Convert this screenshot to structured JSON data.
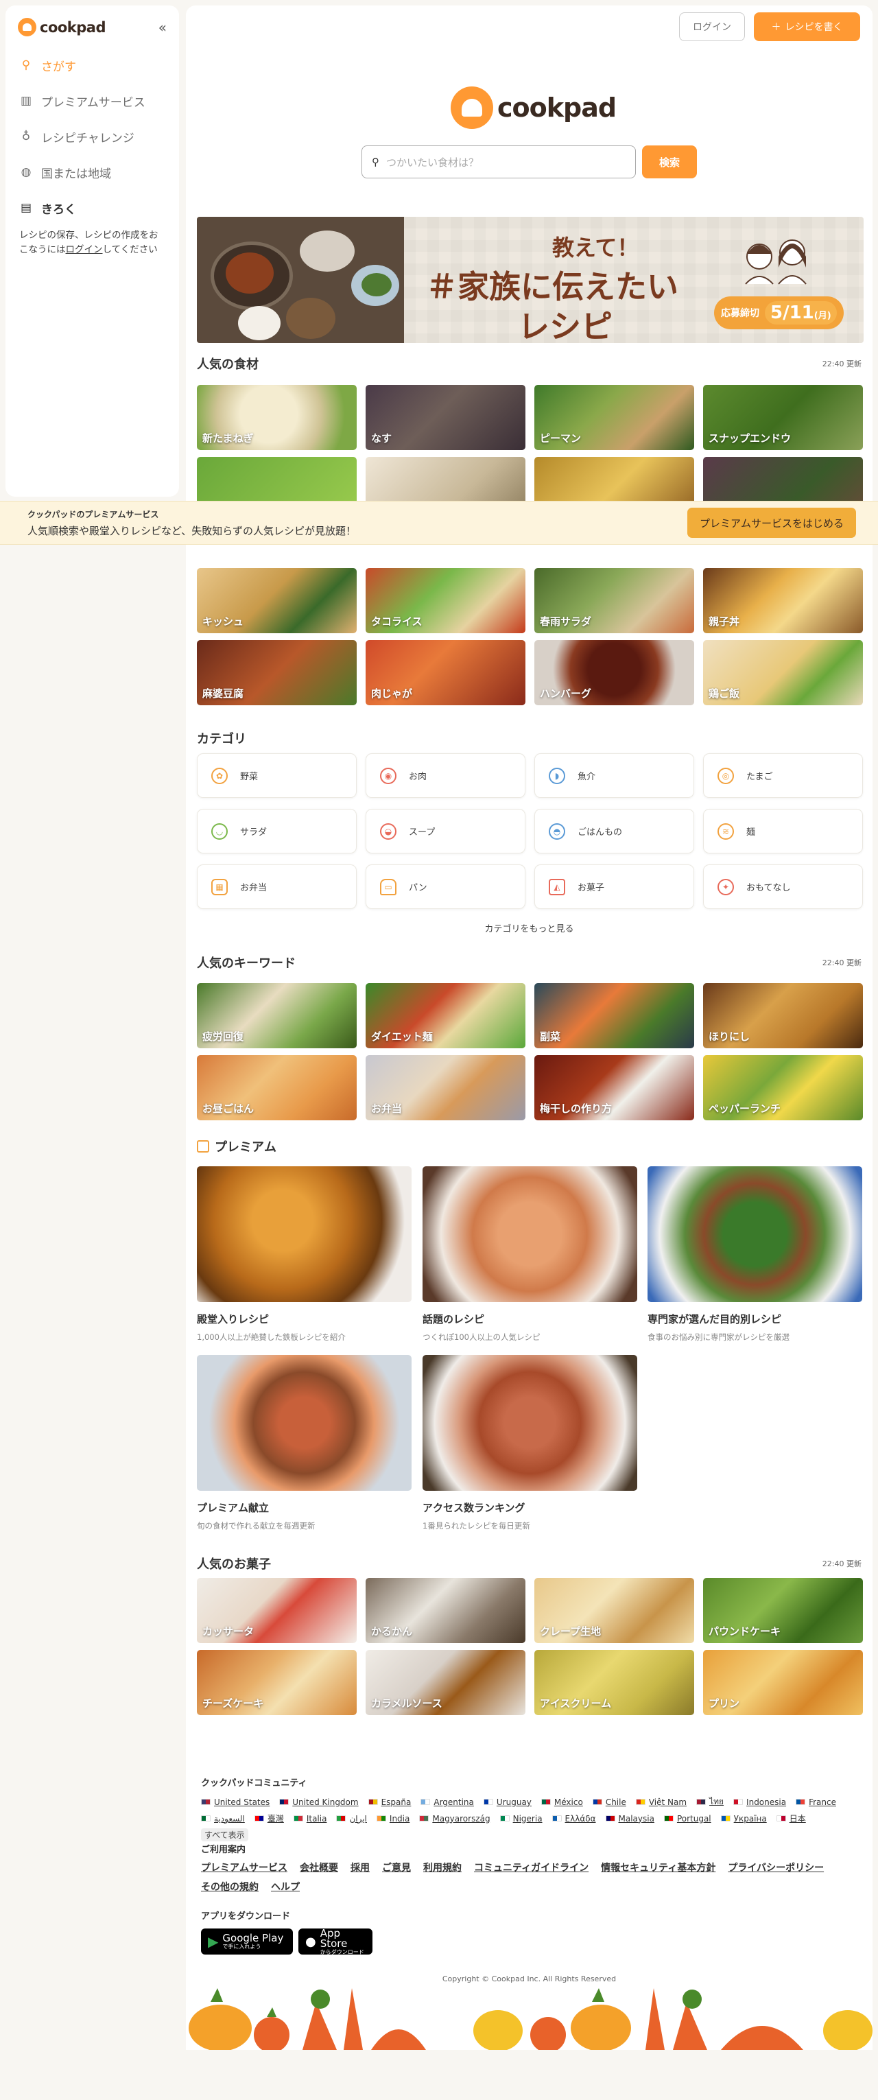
{
  "sidebar": {
    "logo_text": "cookpad",
    "items": [
      {
        "label": "さがす",
        "icon": "search-icon"
      },
      {
        "label": "プレミアムサービス",
        "icon": "premium-building-icon"
      },
      {
        "label": "レシピチャレンジ",
        "icon": "badge-icon"
      },
      {
        "label": "国または地域",
        "icon": "globe-icon"
      },
      {
        "label": "きろく",
        "icon": "notebook-icon"
      }
    ],
    "note_pre": "レシピの保存、レシピの作成をおこなうには",
    "note_link": "ログイン",
    "note_post": "してください"
  },
  "header": {
    "login_label": "ログイン",
    "write_label": "レシピを書く"
  },
  "hero": {
    "logo_text": "cookpad",
    "search_placeholder": "つかいたい食材は？",
    "search_button": "検索"
  },
  "banner": {
    "line1": "教えて！",
    "line2": "＃家族に伝えたい",
    "line3": "レシピ",
    "deadline_label": "応募締切",
    "deadline_date": "5/11",
    "deadline_day": "(月)"
  },
  "popular_ingredients": {
    "title": "人気の食材",
    "updated": "22:40 更新",
    "items": [
      "新たまねぎ",
      "なす",
      "ピーマン",
      "スナップエンドウ",
      "",
      "",
      "",
      ""
    ]
  },
  "premium_bar": {
    "title": "クックパッドのプレミアムサービス",
    "text": "人気順検索や殿堂入りレシピなど、失敗知らずの人気レシピが見放題！",
    "button": "プレミアムサービスをはじめる"
  },
  "popular_dishes": {
    "items": [
      "キッシュ",
      "タコライス",
      "春雨サラダ",
      "親子丼",
      "麻婆豆腐",
      "肉じゃが",
      "ハンバーグ",
      "鶏ご飯"
    ]
  },
  "categories": {
    "title": "カテゴリ",
    "items": [
      {
        "label": "野菜",
        "icon": "vegetable-icon"
      },
      {
        "label": "お肉",
        "icon": "meat-icon"
      },
      {
        "label": "魚介",
        "icon": "fish-icon"
      },
      {
        "label": "たまご",
        "icon": "egg-icon"
      },
      {
        "label": "サラダ",
        "icon": "salad-icon"
      },
      {
        "label": "スープ",
        "icon": "soup-icon"
      },
      {
        "label": "ごはんもの",
        "icon": "rice-icon"
      },
      {
        "label": "麺",
        "icon": "noodle-icon"
      },
      {
        "label": "お弁当",
        "icon": "bento-icon"
      },
      {
        "label": "パン",
        "icon": "bread-icon"
      },
      {
        "label": "お菓子",
        "icon": "cake-icon"
      },
      {
        "label": "おもてなし",
        "icon": "party-icon"
      }
    ],
    "more": "カテゴリをもっと見る"
  },
  "popular_keywords": {
    "title": "人気のキーワード",
    "updated": "22:40 更新",
    "items": [
      "疲労回復",
      "ダイエット麺",
      "副菜",
      "ほりにし",
      "お昼ごはん",
      "お弁当",
      "梅干しの作り方",
      "ペッパーランチ"
    ]
  },
  "premium": {
    "title": "プレミアム",
    "cards": [
      {
        "title": "殿堂入りレシピ",
        "sub": "1,000人以上が絶賛した鉄板レシピを紹介"
      },
      {
        "title": "話題のレシピ",
        "sub": "つくれぽ100人以上の人気レシピ"
      },
      {
        "title": "専門家が選んだ目的別レシピ",
        "sub": "食事のお悩み別に専門家がレシピを厳選"
      },
      {
        "title": "プレミアム献立",
        "sub": "旬の食材で作れる献立を毎週更新"
      },
      {
        "title": "アクセス数ランキング",
        "sub": "1番見られたレシピを毎日更新"
      }
    ]
  },
  "popular_sweets": {
    "title": "人気のお菓子",
    "updated": "22:40 更新",
    "items": [
      "カッサータ",
      "かるかん",
      "クレープ生地",
      "パウンドケーキ",
      "チーズケーキ",
      "カラメルソース",
      "アイスクリーム",
      "プリン"
    ]
  },
  "footer": {
    "community_title": "クックパッドコミュニティ",
    "countries": [
      {
        "name": "United States",
        "c1": "#3c3b6e",
        "c2": "#b22234"
      },
      {
        "name": "United Kingdom",
        "c1": "#012169",
        "c2": "#c8102e"
      },
      {
        "name": "España",
        "c1": "#aa151b",
        "c2": "#f1bf00"
      },
      {
        "name": "Argentina",
        "c1": "#74acdf",
        "c2": "#ffffff"
      },
      {
        "name": "Uruguay",
        "c1": "#0038a8",
        "c2": "#ffffff"
      },
      {
        "name": "México",
        "c1": "#006847",
        "c2": "#ce1126"
      },
      {
        "name": "Chile",
        "c1": "#0039a6",
        "c2": "#d52b1e"
      },
      {
        "name": "Việt Nam",
        "c1": "#da251d",
        "c2": "#ffcd00"
      },
      {
        "name": "ไทย",
        "c1": "#a51931",
        "c2": "#2d2a4a"
      },
      {
        "name": "Indonesia",
        "c1": "#ce1126",
        "c2": "#ffffff"
      },
      {
        "name": "France",
        "c1": "#0055a4",
        "c2": "#ef4135"
      },
      {
        "name": "السعودية",
        "c1": "#006c35",
        "c2": "#ffffff"
      },
      {
        "name": "臺灣",
        "c1": "#fe0000",
        "c2": "#000095"
      },
      {
        "name": "Italia",
        "c1": "#009246",
        "c2": "#ce2b37"
      },
      {
        "name": "ایران",
        "c1": "#239f40",
        "c2": "#da0000"
      },
      {
        "name": "India",
        "c1": "#ff9933",
        "c2": "#138808"
      },
      {
        "name": "Magyarország",
        "c1": "#ce2939",
        "c2": "#477050"
      },
      {
        "name": "Nigeria",
        "c1": "#008751",
        "c2": "#ffffff"
      },
      {
        "name": "Ελλάδα",
        "c1": "#0d5eaf",
        "c2": "#ffffff"
      },
      {
        "name": "Malaysia",
        "c1": "#010066",
        "c2": "#cc0001"
      },
      {
        "name": "Portugal",
        "c1": "#006600",
        "c2": "#ff0000"
      },
      {
        "name": "Україна",
        "c1": "#0057b7",
        "c2": "#ffd700"
      },
      {
        "name": "日本",
        "c1": "#ffffff",
        "c2": "#bc002d"
      }
    ],
    "show_all": "すべて表示",
    "info_title": "ご利用案内",
    "info_links": [
      "プレミアムサービス",
      "会社概要",
      "採用",
      "ご意見",
      "利用規約",
      "コミュニティガイドライン",
      "情報セキュリティ基本方針",
      "プライバシーポリシー",
      "その他の規約",
      "ヘルプ"
    ],
    "app_title": "アプリをダウンロード",
    "google_play": "Google Play",
    "google_sub": "で手に入れよう",
    "app_store": "App Store",
    "app_sub": "からダウンロード",
    "copyright": "Copyright © Cookpad Inc. All Rights Reserved"
  },
  "colors": {
    "accent": "#ff9933",
    "brand_text": "#3a2a21",
    "premium_bg": "#fdf4dd"
  }
}
